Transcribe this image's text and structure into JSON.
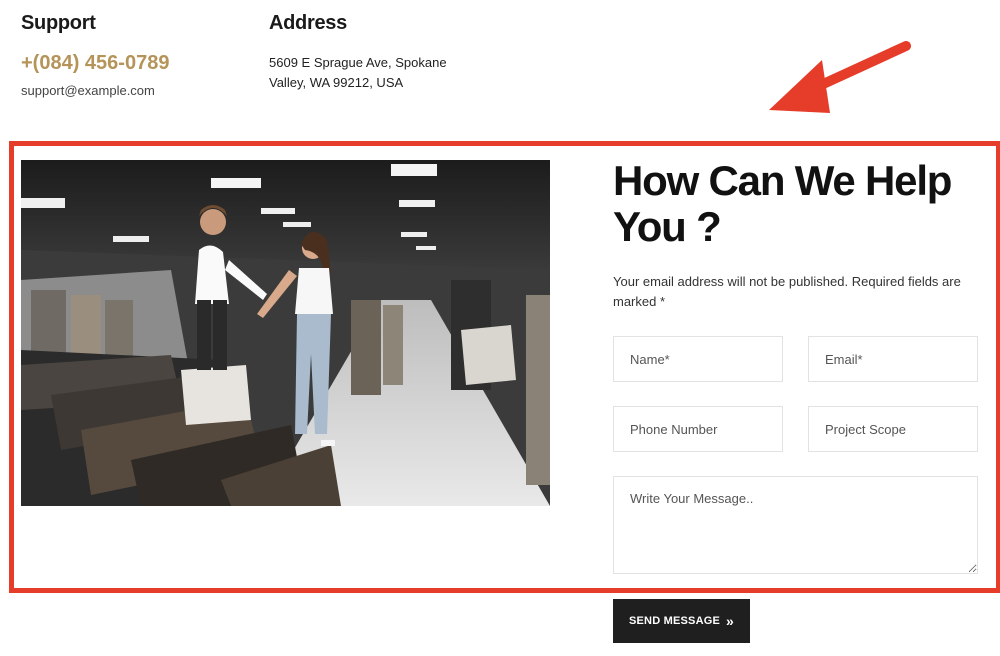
{
  "contact": {
    "support_heading": "Support",
    "phone": "+(084) 456-0789",
    "email": "support@example.com",
    "address_heading": "Address",
    "address_line1": "5609 E Sprague Ave, Spokane",
    "address_line2": "Valley, WA 99212, USA"
  },
  "form": {
    "title": "How Can We Help You ?",
    "note": "Your email address will not be published. Required fields are marked *",
    "name_placeholder": "Name*",
    "email_placeholder": "Email*",
    "phone_placeholder": "Phone Number",
    "scope_placeholder": "Project Scope",
    "message_placeholder": "Write Your Message..",
    "send_label": "SEND MESSAGE",
    "send_icon": "double-chevron-right-icon"
  },
  "colors": {
    "accent": "#b5945a",
    "annotation": "#e63c2a",
    "button_bg": "#1f1f1f"
  }
}
